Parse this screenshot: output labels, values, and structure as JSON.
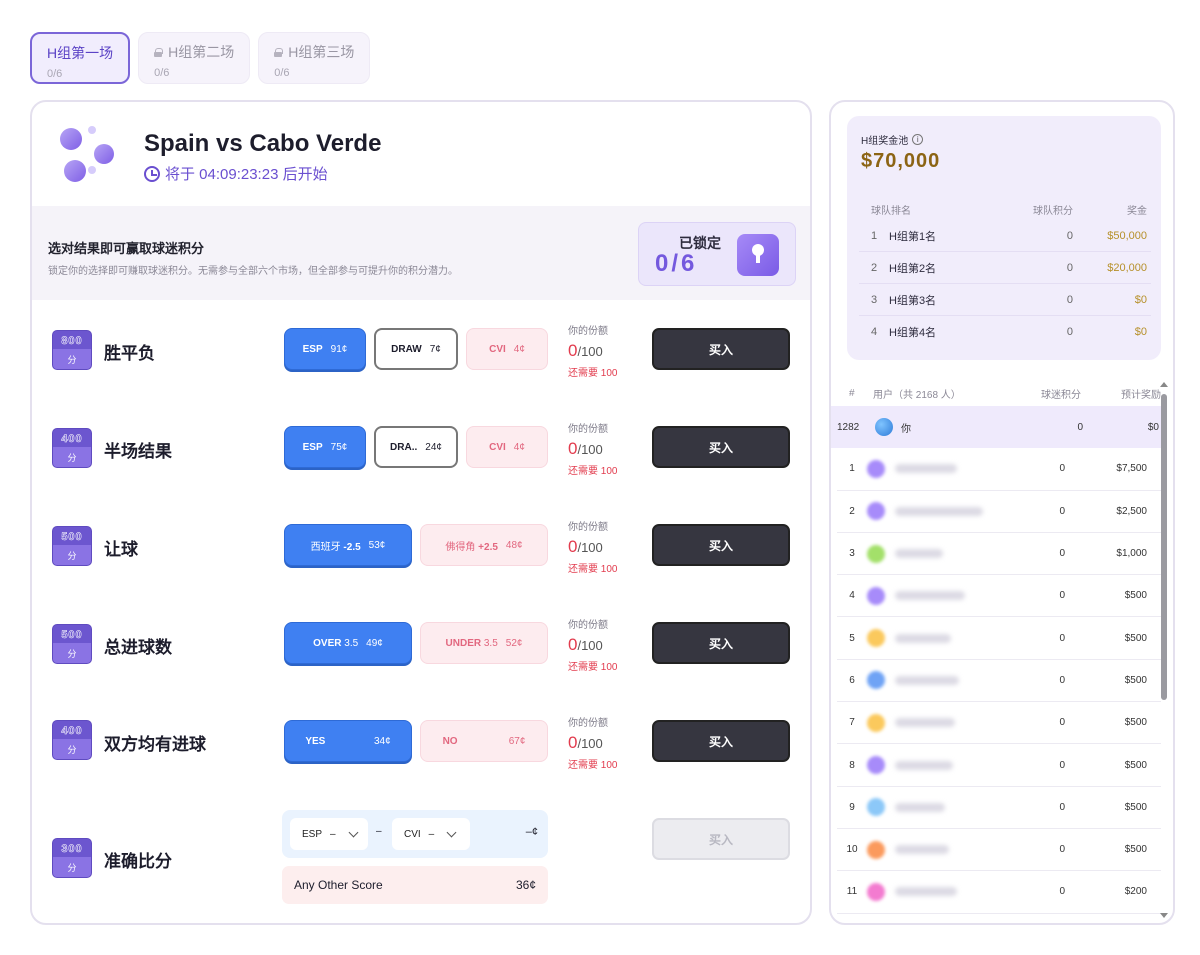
{
  "tabs": [
    {
      "label": "H组第一场",
      "progress": "0/6",
      "locked": false
    },
    {
      "label": "H组第二场",
      "progress": "0/6",
      "locked": true
    },
    {
      "label": "H组第三场",
      "progress": "0/6",
      "locked": true
    }
  ],
  "match": {
    "title": "Spain vs Cabo Verde",
    "countdown": "将于 04:09:23:23 后开始"
  },
  "banner": {
    "title": "选对结果即可赢取球迷积分",
    "subtitle": "锁定你的选择即可赚取球迷积分。无需参与全部六个市场，但全部参与可提升你的积分潜力。",
    "locked_label": "已锁定",
    "locked_value": "0/6"
  },
  "markets": [
    {
      "points": "800",
      "unit": "分",
      "name": "胜平负",
      "options": [
        {
          "label": "ESP",
          "price": "91¢",
          "style": "blue"
        },
        {
          "label": "DRAW",
          "price": "7¢",
          "style": "white"
        },
        {
          "label": "CVI",
          "price": "4¢",
          "style": "pink"
        }
      ],
      "share_label": "你的份额",
      "share_value": "0",
      "share_total": "/100",
      "need": "还需要 100",
      "buy": "买入"
    },
    {
      "points": "400",
      "unit": "分",
      "name": "半场结果",
      "options": [
        {
          "label": "ESP",
          "price": "75¢",
          "style": "blue"
        },
        {
          "label": "DRA..",
          "price": "24¢",
          "style": "white"
        },
        {
          "label": "CVI",
          "price": "4¢",
          "style": "pink"
        }
      ],
      "share_label": "你的份额",
      "share_value": "0",
      "share_total": "/100",
      "need": "还需要 100",
      "buy": "买入"
    },
    {
      "points": "500",
      "unit": "分",
      "name": "让球",
      "options": [
        {
          "label": "西班牙",
          "extra": "-2.5",
          "price": "53¢",
          "style": "blue"
        },
        {
          "label": "佛得角",
          "extra": "+2.5",
          "price": "48¢",
          "style": "pink"
        }
      ],
      "share_label": "你的份额",
      "share_value": "0",
      "share_total": "/100",
      "need": "还需要 100",
      "buy": "买入"
    },
    {
      "points": "500",
      "unit": "分",
      "name": "总进球数",
      "options": [
        {
          "label": "OVER",
          "extra": "3.5",
          "price": "49¢",
          "style": "blue"
        },
        {
          "label": "UNDER",
          "extra": "3.5",
          "price": "52¢",
          "style": "pink"
        }
      ],
      "share_label": "你的份额",
      "share_value": "0",
      "share_total": "/100",
      "need": "还需要 100",
      "buy": "买入"
    },
    {
      "points": "400",
      "unit": "分",
      "name": "双方均有进球",
      "options": [
        {
          "label": "YES",
          "price": "34¢",
          "style": "blue"
        },
        {
          "label": "NO",
          "price": "67¢",
          "style": "pink"
        }
      ],
      "share_label": "你的份额",
      "share_value": "0",
      "share_total": "/100",
      "need": "还需要 100",
      "buy": "买入"
    },
    {
      "points": "300",
      "unit": "分",
      "name": "准确比分",
      "buy": "买入"
    }
  ],
  "exact_score": {
    "home": "ESP",
    "home_val": "–",
    "dash": "–",
    "away": "CVI",
    "away_val": "–",
    "price": "–¢",
    "other_label": "Any Other Score",
    "other_price": "36¢"
  },
  "pool": {
    "title": "H组奖金池",
    "info": "i",
    "amount": "$70,000",
    "headers": [
      "球队排名",
      "球队积分",
      "奖金"
    ],
    "rows": [
      {
        "n": "1",
        "team": "H组第1名",
        "pts": "0",
        "prize": "$50,000"
      },
      {
        "n": "2",
        "team": "H组第2名",
        "pts": "0",
        "prize": "$20,000"
      },
      {
        "n": "3",
        "team": "H组第3名",
        "pts": "0",
        "prize": "$0"
      },
      {
        "n": "4",
        "team": "H组第4名",
        "pts": "0",
        "prize": "$0"
      }
    ]
  },
  "leaderboard": {
    "headers": [
      "#",
      "用户（共 2168 人）",
      "球迷积分",
      "预计奖励"
    ],
    "me": {
      "rank": "1282",
      "name": "你",
      "pts": "0",
      "reward": "$0"
    },
    "rows": [
      {
        "rank": "1",
        "pts": "0",
        "reward": "$7,500",
        "color": "#a78bfa"
      },
      {
        "rank": "2",
        "pts": "0",
        "reward": "$2,500",
        "color": "#a78bfa"
      },
      {
        "rank": "3",
        "pts": "0",
        "reward": "$1,000",
        "color": "#a3e06a"
      },
      {
        "rank": "4",
        "pts": "0",
        "reward": "$500",
        "color": "#a78bfa"
      },
      {
        "rank": "5",
        "pts": "0",
        "reward": "$500",
        "color": "#fbc95d"
      },
      {
        "rank": "6",
        "pts": "0",
        "reward": "$500",
        "color": "#6fa3f5"
      },
      {
        "rank": "7",
        "pts": "0",
        "reward": "$500",
        "color": "#fbc95d"
      },
      {
        "rank": "8",
        "pts": "0",
        "reward": "$500",
        "color": "#a78bfa"
      },
      {
        "rank": "9",
        "pts": "0",
        "reward": "$500",
        "color": "#8cc8f8"
      },
      {
        "rank": "10",
        "pts": "0",
        "reward": "$500",
        "color": "#fb9a5d"
      },
      {
        "rank": "11",
        "pts": "0",
        "reward": "$200",
        "color": "#f37bd0"
      }
    ]
  },
  "colors": {
    "accent": "#6a4fd0",
    "blue": "#3f80f2",
    "pink": "#fdecef",
    "red": "#e23c4e",
    "gold": "#8c6414"
  }
}
